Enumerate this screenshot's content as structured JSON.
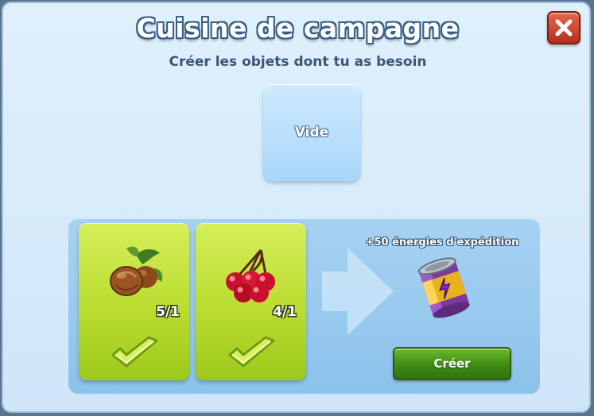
{
  "dialog": {
    "title": "Cuisine de campagne",
    "subtitle": "Créer les objets dont tu as besoin"
  },
  "result_slot": {
    "label": "Vide"
  },
  "ingredients": [
    {
      "icon": "hazelnut-icon",
      "count": "5/1",
      "satisfied": true
    },
    {
      "icon": "cherries-icon",
      "count": "4/1",
      "satisfied": true
    }
  ],
  "reward": {
    "text": "+50 énergies d'expédition",
    "icon": "energy-can-icon"
  },
  "buttons": {
    "create_label": "Créer"
  },
  "colors": {
    "ingredient_green": "#b7db2c",
    "create_green": "#3f8b15",
    "close_red": "#c0392b",
    "panel_blue": "#a7d2f2"
  }
}
